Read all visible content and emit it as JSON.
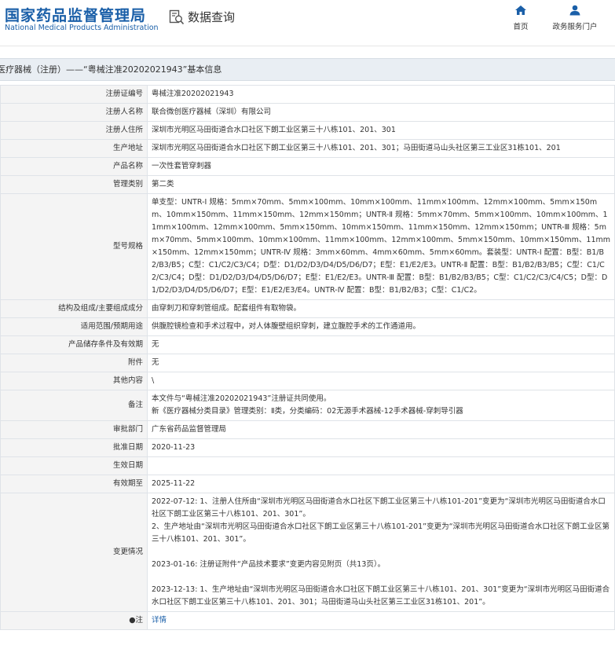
{
  "header": {
    "logo_cn": "国家药品监督管理局",
    "logo_en": "National Medical Products Administration",
    "query_title": "数据查询",
    "nav": [
      {
        "label": "首页",
        "icon": "home-icon"
      },
      {
        "label": "政务服务门户",
        "icon": "user-icon"
      }
    ]
  },
  "title_bar": "医疗器械（注册）——“粤械注准20202021943”基本信息",
  "rows": {
    "reg_no": {
      "label": "注册证编号",
      "value": "粤械注准20202021943"
    },
    "registrant": {
      "label": "注册人名称",
      "value": "联合微创医疗器械（深圳）有限公司"
    },
    "registrant_addr": {
      "label": "注册人住所",
      "value": "深圳市光明区马田街道合水口社区下朗工业区第三十八栋101、201、301"
    },
    "prod_addr": {
      "label": "生产地址",
      "value": "深圳市光明区马田街道合水口社区下朗工业区第三十八栋101、201、301；马田街道马山头社区第三工业区31栋101、201"
    },
    "product_name": {
      "label": "产品名称",
      "value": "一次性套管穿刺器"
    },
    "mgmt_class": {
      "label": "管理类别",
      "value": "第二类"
    },
    "model_spec": {
      "label": "型号规格",
      "value": "单支型：UNTR-Ⅰ 规格：5mm×70mm、5mm×100mm、10mm×100mm、11mm×100mm、12mm×100mm、5mm×150mm、10mm×150mm、11mm×150mm、12mm×150mm；UNTR-Ⅱ 规格：5mm×70mm、5mm×100mm、10mm×100mm、11mm×100mm、12mm×100mm、5mm×150mm、10mm×150mm、11mm×150mm、12mm×150mm；UNTR-Ⅲ 规格：5mm×70mm、5mm×100mm、10mm×100mm、11mm×100mm、12mm×100mm、5mm×150mm、10mm×150mm、11mm×150mm、12mm×150mm；UNTR-Ⅳ 规格：3mm×60mm、4mm×60mm、5mm×60mm。套装型：UNTR-Ⅰ 配置：B型：B1/B2/B3/B5；C型：C1/C2/C3/C4；D型：D1/D2/D3/D4/D5/D6/D7；E型：E1/E2/E3。UNTR-Ⅱ 配置：B型：B1/B2/B3/B5；C型：C1/C2/C3/C4；D型：D1/D2/D3/D4/D5/D6/D7；E型：E1/E2/E3。UNTR-Ⅲ 配置：B型：B1/B2/B3/B5；C型：C1/C2/C3/C4/C5；D型：D1/D2/D3/D4/D5/D6/D7；E型：E1/E2/E3/E4。UNTR-Ⅳ 配置：B型：B1/B2/B3；C型：C1/C2。"
    },
    "structure": {
      "label": "结构及组成/主要组成成分",
      "value": "由穿刺刀和穿刺管组成。配套组件有取物袋。"
    },
    "scope": {
      "label": "适用范围/预期用途",
      "value": "供腹腔镜检查和手术过程中，对人体腹壁组织穿刺，建立腹腔手术的工作通道用。"
    },
    "storage": {
      "label": "产品储存条件及有效期",
      "value": "无"
    },
    "attachment": {
      "label": "附件",
      "value": "无"
    },
    "other": {
      "label": "其他内容",
      "value": "\\"
    },
    "remarks": {
      "label": "备注",
      "lines": [
        "本文件与“粤械注准20202021943”注册证共同使用。",
        "新《医疗器械分类目录》管理类别：Ⅱ类，分类编码：02无源手术器械-12手术器械-穿刺导引器"
      ]
    },
    "approval_dept": {
      "label": "审批部门",
      "value": "广东省药品监督管理局"
    },
    "approval_date": {
      "label": "批准日期",
      "value": "2020-11-23"
    },
    "effective_date": {
      "label": "生效日期",
      "value": ""
    },
    "valid_until": {
      "label": "有效期至",
      "value": "2025-11-22"
    },
    "changes": {
      "label": "变更情况",
      "paras": [
        "2022-07-12: 1、注册人住所由“深圳市光明区马田街道合水口社区下朗工业区第三十八栋101-201”变更为“深圳市光明区马田街道合水口社区下朗工业区第三十八栋101、201、301”。",
        "2、生产地址由“深圳市光明区马田街道合水口社区下朗工业区第三十八栋101-201”变更为“深圳市光明区马田街道合水口社区下朗工业区第三十八栋101、201、301”。",
        "2023-01-16: 注册证附件“产品技术要求”变更内容见附页（共13页）。",
        "2023-12-13: 1、生产地址由“深圳市光明区马田街道合水口社区下朗工业区第三十八栋101、201、301”变更为“深圳市光明区马田街道合水口社区下朗工业区第三十八栋101、201、301；马田街道马山头社区第三工业区31栋101、201”。"
      ]
    },
    "note": {
      "label": "注",
      "icon": "note-icon",
      "link": "详情"
    }
  }
}
